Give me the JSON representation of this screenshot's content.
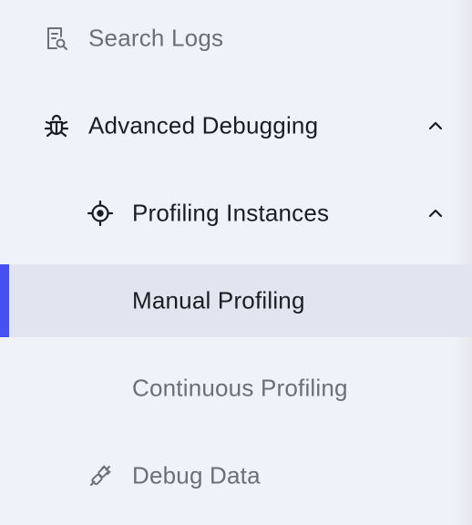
{
  "nav": {
    "search_logs": {
      "label": "Search Logs",
      "icon": "search-document-icon"
    },
    "advanced_debugging": {
      "label": "Advanced Debugging",
      "icon": "bug-icon",
      "expanded": true
    },
    "profiling_instances": {
      "label": "Profiling Instances",
      "icon": "crosshair-icon",
      "expanded": true
    },
    "manual_profiling": {
      "label": "Manual Profiling",
      "active": true
    },
    "continuous_profiling": {
      "label": "Continuous Profiling"
    },
    "debug_data": {
      "label": "Debug Data",
      "icon": "plug-icon"
    }
  },
  "colors": {
    "background": "#f0f2f9",
    "active_background": "#e2e4ef",
    "accent": "#4450f2",
    "text_strong": "#1b1d22",
    "text_muted": "#6b6f78"
  }
}
